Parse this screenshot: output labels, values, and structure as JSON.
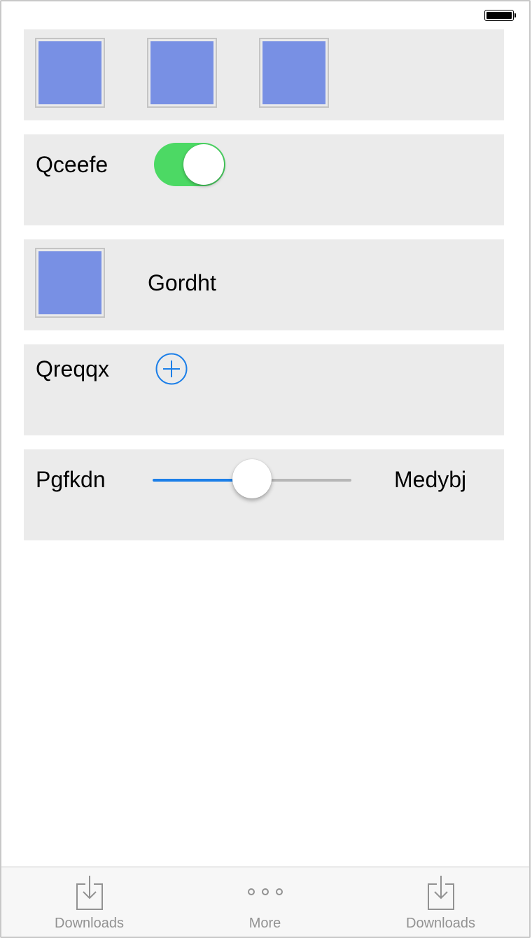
{
  "status_bar": {
    "battery_icon": "battery-full-icon"
  },
  "rows": {
    "toggle_row": {
      "label": "Qceefe",
      "toggle_on": true,
      "toggle_color": "#4cd964"
    },
    "image_label_row": {
      "label": "Gordht"
    },
    "add_row": {
      "label": "Qreqqx",
      "button_icon": "add-circle-icon",
      "accent": "#1c7fe8"
    },
    "slider_row": {
      "label": "Pgfkdn",
      "value_label": "Medybj",
      "value_fraction": 0.5,
      "accent": "#1c7fe8"
    }
  },
  "colors": {
    "row_background": "#ebebeb",
    "image_placeholder": "#7890e4"
  },
  "tab_bar": {
    "tabs": [
      {
        "label": "Downloads",
        "icon": "download-icon"
      },
      {
        "label": "More",
        "icon": "more-dots-icon"
      },
      {
        "label": "Downloads",
        "icon": "download-icon"
      }
    ]
  }
}
